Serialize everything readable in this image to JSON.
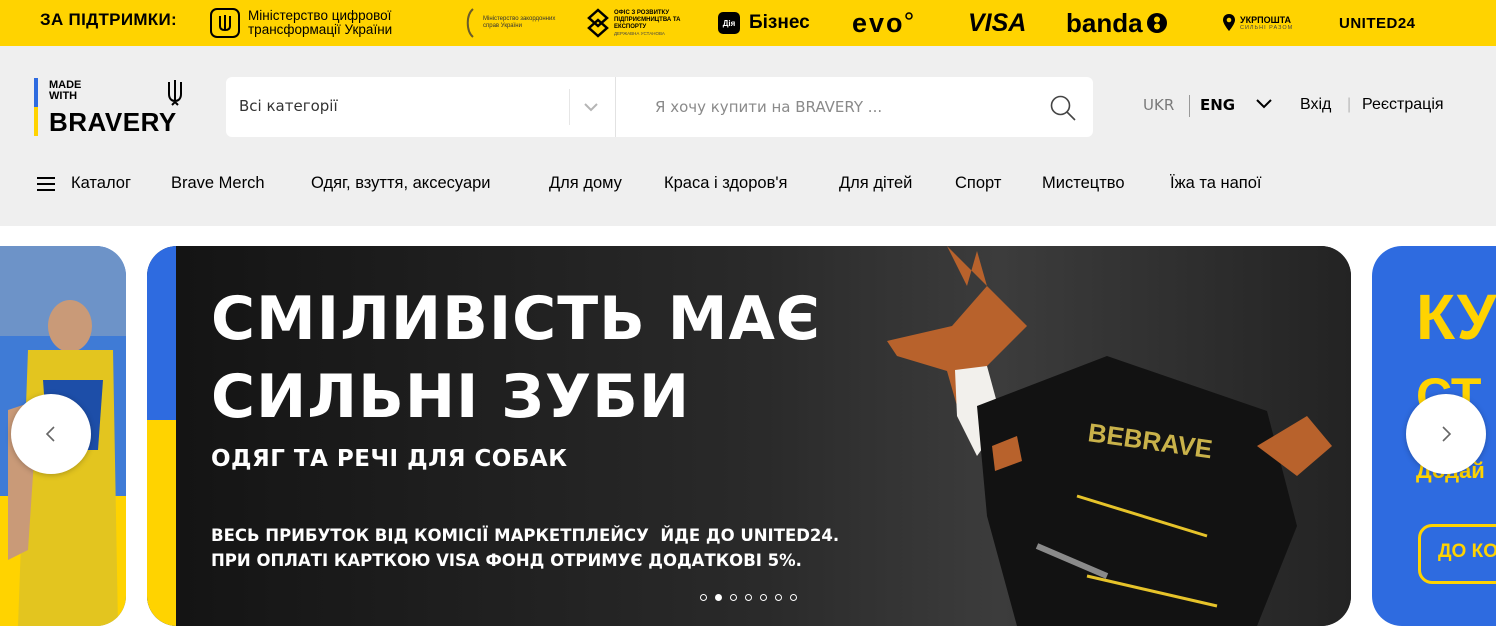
{
  "support_bar": {
    "label": "ЗА ПІДТРИМКИ:",
    "sponsors": {
      "mintsyfra": "Міністерство цифрової\nтрансформації України",
      "mzs": "Міністерство закордонних справ України",
      "office": "ОФІС З РОЗВИТКУ ПІДПРИЄМНИЦТВА ТА ЕКСПОРТУ",
      "office_sub": "ДЕРЖАВНА УСТАНОВА",
      "diia_badge": "Дія",
      "diia_business": "Бізнес",
      "evo": "evo",
      "visa": "VISA",
      "banda": "banda",
      "ukrposhta": "УКРПОШТА",
      "ukrposhta_sub": "СИЛЬНІ РАЗОМ",
      "united24": "UNITED24"
    }
  },
  "header": {
    "logo": {
      "line1": "MADE",
      "line2": "WITH",
      "line3": "BRAVERY"
    },
    "search": {
      "category": "Всі категорії",
      "placeholder": "Я хочу купити на BRAVERY ..."
    },
    "lang": {
      "ukr": "UKR",
      "eng": "ENG"
    },
    "auth": {
      "login": "Вхід",
      "separator": "|",
      "register": "Реєстрація"
    }
  },
  "nav": {
    "catalog": "Каталог",
    "items": [
      "Brave Merch",
      "Одяг, взуття, аксесуари",
      "Для дому",
      "Краса і здоров'я",
      "Для дітей",
      "Спорт",
      "Мистецтво",
      "Їжа та напої"
    ]
  },
  "hero": {
    "title_line1": "СМІЛИВІСТЬ МАЄ",
    "title_line2": "СИЛЬНІ ЗУБИ",
    "subtitle": "ОДЯГ ТА РЕЧІ ДЛЯ СОБАК",
    "note_line1": "ВЕСЬ ПРИБУТОК ВІД КОМІСІЇ МАРКЕТПЛЕЙСУ  ЙДЕ ДО UNITED24.",
    "note_line2": "ПРИ ОПЛАТІ КАРТКОЮ VISA ФОНД ОТРИМУЄ ДОДАТКОВІ 5%.",
    "jacket_text": "BEBRAVE",
    "active_slide": 2,
    "slide_count": 7
  },
  "side_card": {
    "text1": "КУ",
    "text2": "СТ",
    "text3": "Додай",
    "button": "ДО КО"
  },
  "colors": {
    "yellow": "#ffd300",
    "blue": "#2e6be0",
    "header_bg": "#efefef",
    "hero_bg": "#1d1d1d"
  }
}
